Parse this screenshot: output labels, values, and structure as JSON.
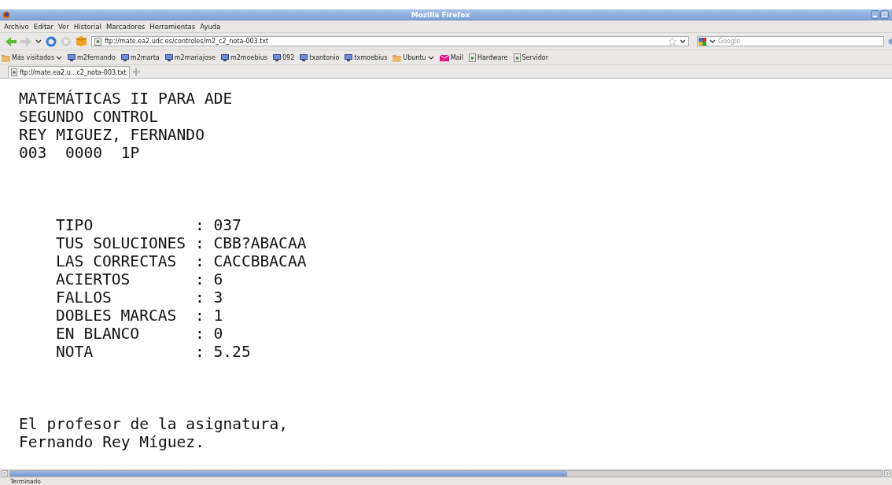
{
  "window": {
    "title": "Mozilla Firefox"
  },
  "menu": [
    "Archivo",
    "Editar",
    "Ver",
    "Historial",
    "Marcadores",
    "Herramientas",
    "Ayuda"
  ],
  "address_bar": {
    "value": "ftp://mate.ea2.udc.es/controles/m2_c2_nota-003.txt"
  },
  "search_bar": {
    "placeholder": "Google"
  },
  "bookmarks": [
    {
      "label": "Más visitados",
      "kind": "folder",
      "dropdown": true
    },
    {
      "label": "m2fernando",
      "kind": "monitor",
      "dropdown": false
    },
    {
      "label": "m2marta",
      "kind": "monitor",
      "dropdown": false
    },
    {
      "label": "m2mariajose",
      "kind": "monitor",
      "dropdown": false
    },
    {
      "label": "m2moebius",
      "kind": "monitor",
      "dropdown": false
    },
    {
      "label": "092",
      "kind": "monitor",
      "dropdown": false
    },
    {
      "label": "txantonio",
      "kind": "monitor",
      "dropdown": false
    },
    {
      "label": "txmoebius",
      "kind": "monitor",
      "dropdown": false
    },
    {
      "label": "Ubuntu",
      "kind": "folder",
      "dropdown": true
    },
    {
      "label": "Mail",
      "kind": "mail",
      "dropdown": false
    },
    {
      "label": "Hardware",
      "kind": "page",
      "dropdown": false
    },
    {
      "label": "Servidor",
      "kind": "page",
      "dropdown": false
    }
  ],
  "tabs": [
    {
      "label": "ftp://mate.ea2.u...c2_nota-003.txt",
      "selected": true
    }
  ],
  "document": {
    "header_lines": [
      "MATEMÁTICAS II PARA ADE",
      "SEGUNDO CONTROL",
      "REY MIGUEZ, FERNANDO",
      "003  0000  1P"
    ],
    "fields": [
      {
        "label": "TIPO",
        "separator": ":",
        "value": "037"
      },
      {
        "label": "TUS SOLUCIONES",
        "separator": ":",
        "value": "CBB?ABACAA"
      },
      {
        "label": "LAS CORRECTAS",
        "separator": ":",
        "value": "CACCBBACAA"
      },
      {
        "label": "ACIERTOS",
        "separator": ":",
        "value": "6"
      },
      {
        "label": "FALLOS",
        "separator": ":",
        "value": "3"
      },
      {
        "label": "DOBLES MARCAS",
        "separator": ":",
        "value": "1"
      },
      {
        "label": "EN BLANCO",
        "separator": ":",
        "value": "0"
      },
      {
        "label": "NOTA",
        "separator": ":",
        "value": "5.25"
      }
    ],
    "footer_lines": [
      "El profesor de la asignatura,",
      "Fernando Rey Míguez."
    ]
  },
  "status_bar": {
    "text": "Terminado"
  }
}
